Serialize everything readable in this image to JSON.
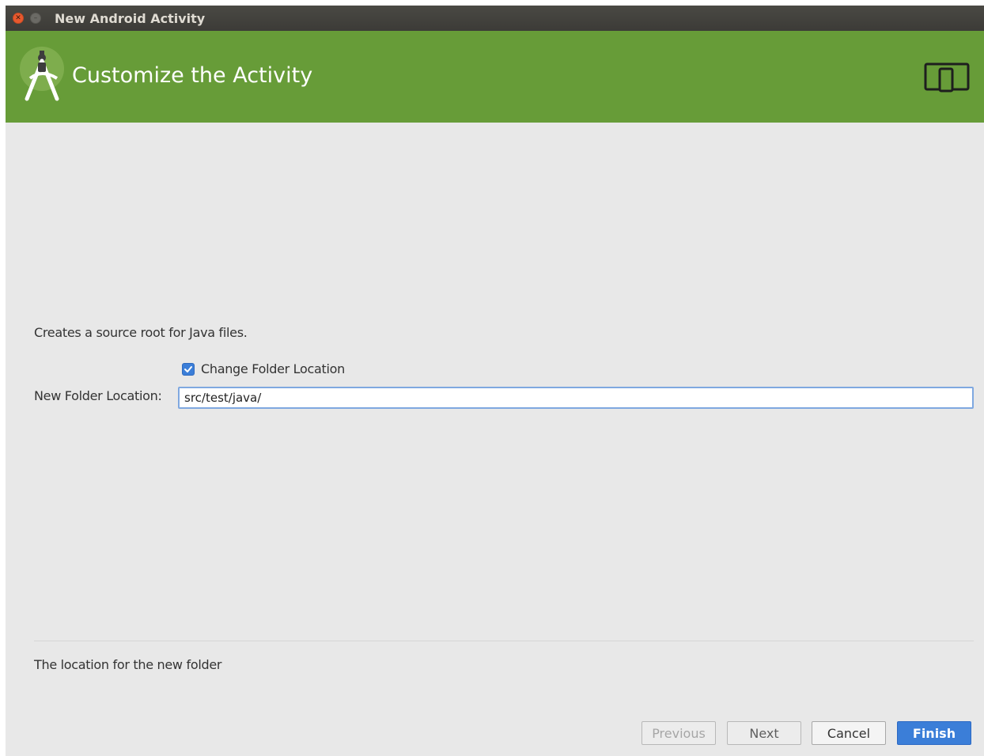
{
  "window": {
    "title": "New Android Activity"
  },
  "header": {
    "title": "Customize the Activity",
    "logo_icon": "android-studio-logo-icon",
    "device_icon": "phone-tablet-icon",
    "color": "#679c38"
  },
  "form": {
    "description": "Creates a source root for Java files.",
    "checkbox_label": "Change Folder Location",
    "checkbox_checked": true,
    "field_label": "New Folder Location:",
    "field_value": "src/test/java/"
  },
  "footer": {
    "hint": "The location for the new folder"
  },
  "buttons": {
    "previous": "Previous",
    "next": "Next",
    "cancel": "Cancel",
    "finish": "Finish"
  },
  "colors": {
    "accent": "#3b7ed8",
    "background": "#e8e8e8",
    "titlebar": "#3c3b37"
  }
}
